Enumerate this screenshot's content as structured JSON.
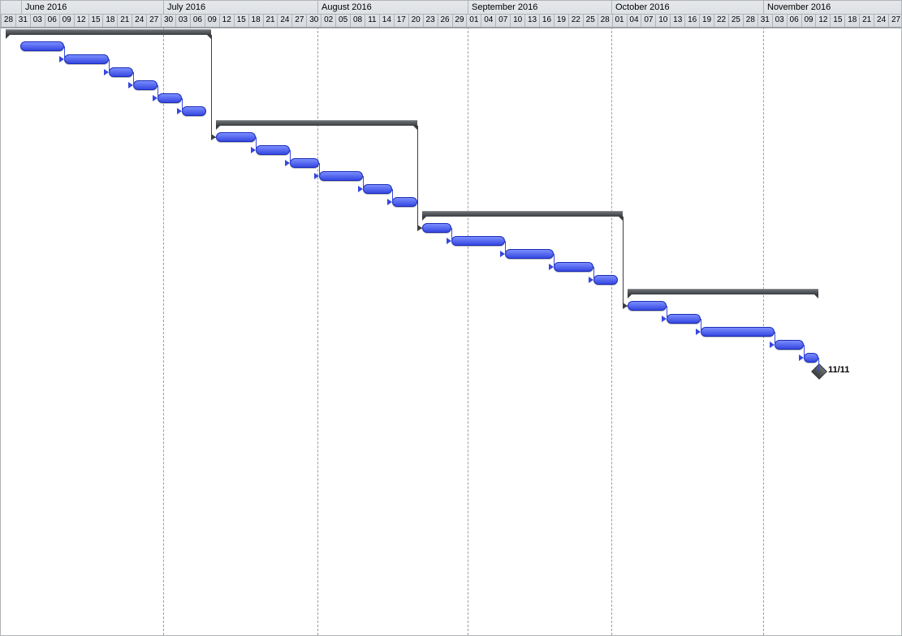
{
  "timeline": {
    "startDay": "2016-05-28",
    "pxPerDay": 6.03,
    "months": [
      {
        "label": "June 2016",
        "startX": 25
      },
      {
        "label": "July 2016",
        "startX": 200
      },
      {
        "label": "August 2016",
        "startX": 390
      },
      {
        "label": "September 2016",
        "startX": 575
      },
      {
        "label": "October 2016",
        "startX": 752
      },
      {
        "label": "November 2016",
        "startX": 939
      }
    ],
    "dayTicks": [
      "28",
      "31",
      "03",
      "06",
      "09",
      "12",
      "15",
      "18",
      "21",
      "24",
      "27",
      "30",
      "03",
      "06",
      "09",
      "12",
      "15",
      "18",
      "21",
      "24",
      "27",
      "30",
      "02",
      "05",
      "08",
      "11",
      "14",
      "17",
      "20",
      "23",
      "26",
      "29",
      "01",
      "04",
      "07",
      "10",
      "13",
      "16",
      "19",
      "22",
      "25",
      "28",
      "01",
      "04",
      "07",
      "10",
      "13",
      "16",
      "19",
      "22",
      "25",
      "28",
      "31",
      "03",
      "06",
      "09",
      "12",
      "15",
      "18",
      "21",
      "24",
      "27"
    ]
  },
  "chart_data": {
    "type": "gantt",
    "date_range": [
      "2016-05-28",
      "2016-11-27"
    ],
    "summaries": [
      {
        "id": "S1",
        "start": "2016-05-29",
        "end": "2016-07-10"
      },
      {
        "id": "S2",
        "start": "2016-07-11",
        "end": "2016-08-21"
      },
      {
        "id": "S3",
        "start": "2016-08-22",
        "end": "2016-10-02"
      },
      {
        "id": "S4",
        "start": "2016-10-03",
        "end": "2016-11-11"
      }
    ],
    "tasks": [
      {
        "phase": "S1",
        "start": "2016-06-01",
        "end": "2016-06-10"
      },
      {
        "phase": "S1",
        "start": "2016-06-10",
        "end": "2016-06-19"
      },
      {
        "phase": "S1",
        "start": "2016-06-19",
        "end": "2016-06-24"
      },
      {
        "phase": "S1",
        "start": "2016-06-24",
        "end": "2016-06-29"
      },
      {
        "phase": "S1",
        "start": "2016-06-29",
        "end": "2016-07-04"
      },
      {
        "phase": "S1",
        "start": "2016-07-04",
        "end": "2016-07-09"
      },
      {
        "phase": "S2",
        "start": "2016-07-11",
        "end": "2016-07-19"
      },
      {
        "phase": "S2",
        "start": "2016-07-19",
        "end": "2016-07-26"
      },
      {
        "phase": "S2",
        "start": "2016-07-26",
        "end": "2016-08-01"
      },
      {
        "phase": "S2",
        "start": "2016-08-01",
        "end": "2016-08-10"
      },
      {
        "phase": "S2",
        "start": "2016-08-10",
        "end": "2016-08-16"
      },
      {
        "phase": "S2",
        "start": "2016-08-16",
        "end": "2016-08-21"
      },
      {
        "phase": "S3",
        "start": "2016-08-22",
        "end": "2016-08-28"
      },
      {
        "phase": "S3",
        "start": "2016-08-28",
        "end": "2016-09-08"
      },
      {
        "phase": "S3",
        "start": "2016-09-08",
        "end": "2016-09-18"
      },
      {
        "phase": "S3",
        "start": "2016-09-18",
        "end": "2016-09-26"
      },
      {
        "phase": "S3",
        "start": "2016-09-26",
        "end": "2016-10-01"
      },
      {
        "phase": "S4",
        "start": "2016-10-03",
        "end": "2016-10-11"
      },
      {
        "phase": "S4",
        "start": "2016-10-11",
        "end": "2016-10-18"
      },
      {
        "phase": "S4",
        "start": "2016-10-18",
        "end": "2016-11-02"
      },
      {
        "phase": "S4",
        "start": "2016-11-02",
        "end": "2016-11-08"
      },
      {
        "phase": "S4",
        "start": "2016-11-08",
        "end": "2016-11-11"
      }
    ],
    "milestones": [
      {
        "date": "2016-11-11",
        "label": "11/11"
      }
    ],
    "dependencies": "finish-to-start sequential between consecutive tasks; each summary end links down to next summary's first task"
  }
}
